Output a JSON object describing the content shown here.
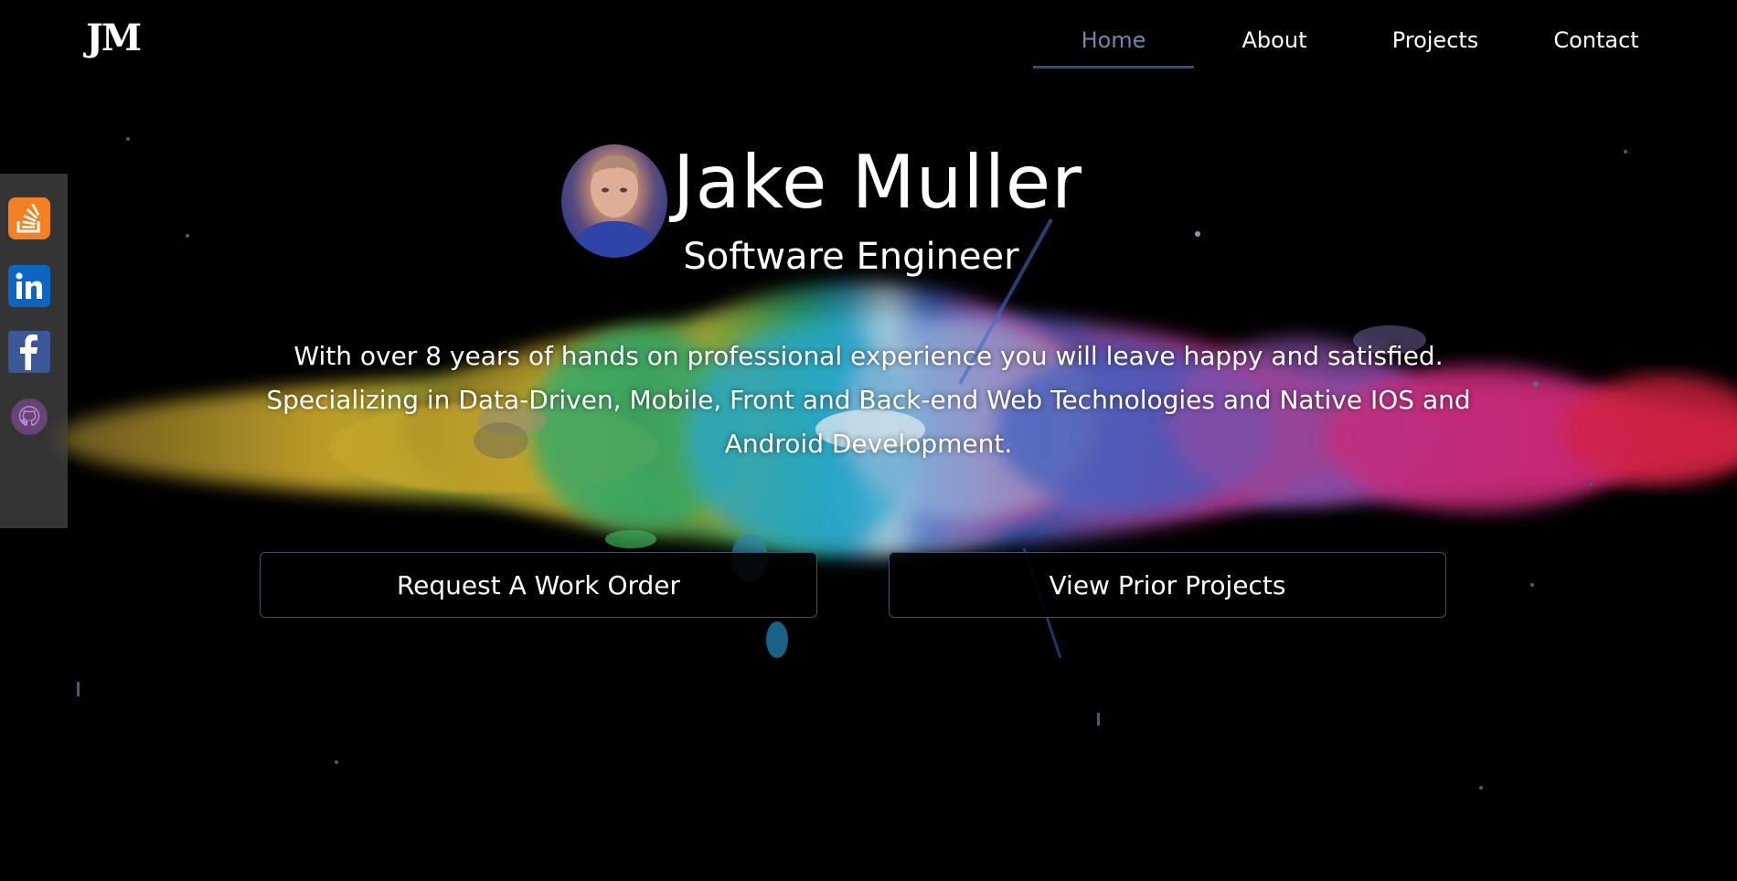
{
  "header": {
    "logo": "JM",
    "nav": [
      {
        "label": "Home",
        "active": true
      },
      {
        "label": "About",
        "active": false
      },
      {
        "label": "Projects",
        "active": false
      },
      {
        "label": "Contact",
        "active": false
      }
    ]
  },
  "social": [
    {
      "icon": "stackoverflow-icon"
    },
    {
      "icon": "linkedin-icon"
    },
    {
      "icon": "facebook-icon"
    },
    {
      "icon": "github-icon"
    }
  ],
  "hero": {
    "name": "Jake Muller",
    "title": "Software Engineer",
    "description": "With over 8 years of hands on professional experience you will leave happy and satisfied. Specializing in Data-Driven, Mobile, Front and Back-end Web Technologies and Native IOS and Android Development.",
    "buttons": {
      "request": "Request A Work Order",
      "projects": "View Prior Projects"
    }
  },
  "colors": {
    "background": "#000000",
    "nav_active": "#6c88aa",
    "button_border": "#44536a"
  }
}
